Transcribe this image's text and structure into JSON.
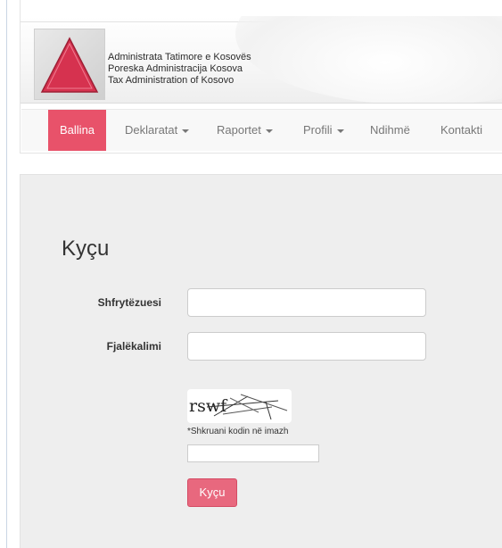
{
  "header": {
    "org_names": [
      "Administrata Tatimore e Kosovës",
      "Poreska Administracija Kosova",
      "Tax Administration of Kosovo"
    ]
  },
  "nav": {
    "items": [
      {
        "label": "Ballina",
        "active": true,
        "dropdown": false
      },
      {
        "label": "Deklaratat",
        "active": false,
        "dropdown": true
      },
      {
        "label": "Raportet",
        "active": false,
        "dropdown": true
      },
      {
        "label": "Profili",
        "active": false,
        "dropdown": true
      },
      {
        "label": "Ndihmë",
        "active": false,
        "dropdown": false
      },
      {
        "label": "Kontakti",
        "active": false,
        "dropdown": false
      }
    ]
  },
  "login": {
    "title": "Kyçu",
    "username_label": "Shfrytëzuesi",
    "username_value": "",
    "password_label": "Fjalëkalimi",
    "password_value": "",
    "captcha_text": "rswf",
    "captcha_hint": "*Shkruani kodin në imazh",
    "captcha_value": "",
    "submit_label": "Kyçu"
  },
  "colors": {
    "accent": "#e8526a",
    "button": "#e8687e",
    "logo_triangle": "#d6324f",
    "panel_bg": "#eeeeee",
    "nav_text": "#777777"
  },
  "icons": {
    "logo": "red-triangle-logo-icon",
    "dropdown": "caret-down-icon"
  }
}
